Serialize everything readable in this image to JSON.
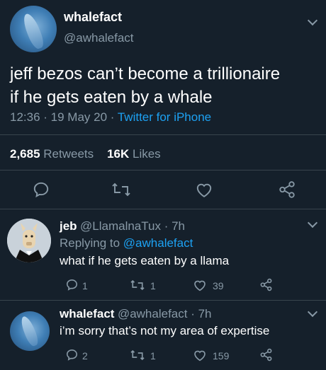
{
  "main": {
    "name": "whalefact",
    "handle": "@awhalefact",
    "text_line1": "jeff bezos can’t become a trillionaire",
    "text_line2": "if he gets eaten by a whale",
    "time": "12:36 · 19 May 20 ·",
    "source": "Twitter for iPhone",
    "retweets_count": "2,685",
    "retweets_label": "Retweets",
    "likes_count": "16K",
    "likes_label": "Likes"
  },
  "replies": [
    {
      "name": "jeb",
      "handle": "@LlamalnaTux · 7h",
      "replying_prefix": "Replying to",
      "replying_handle": "@awhalefact",
      "text": "what if he gets eaten by a llama",
      "reply_count": "1",
      "retweet_count": "1",
      "like_count": "39"
    },
    {
      "name": "whalefact",
      "handle": "@awhalefact · 7h",
      "text": "i’m sorry that’s not my area of expertise",
      "reply_count": "2",
      "retweet_count": "1",
      "like_count": "159"
    }
  ],
  "colors": {
    "background": "#15202b",
    "secondary_text": "#8899a6",
    "link": "#1da1f2",
    "separator": "#38444d"
  }
}
